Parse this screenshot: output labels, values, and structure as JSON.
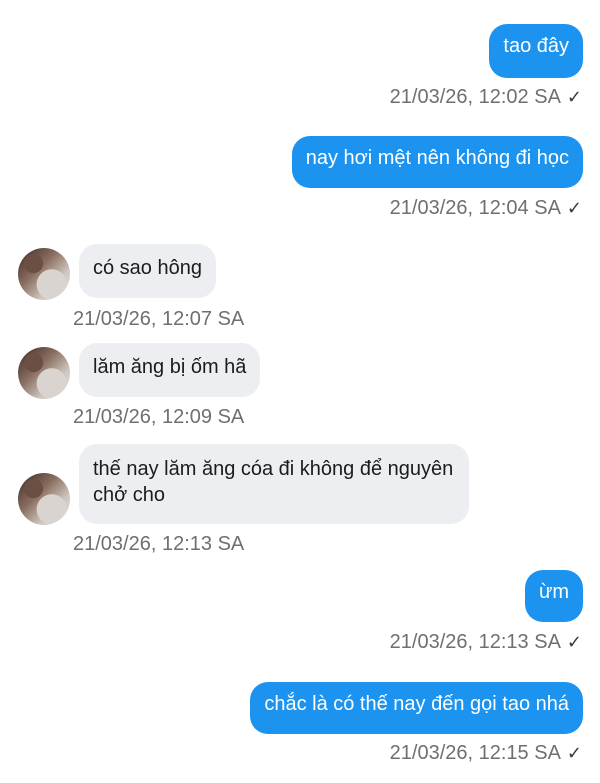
{
  "messages": [
    {
      "side": "out",
      "text": "tao đây",
      "time": "21/03/26, 12:02 SA",
      "status": "✓"
    },
    {
      "side": "out",
      "text": "nay hơi mệt nên không đi học",
      "time": "21/03/26, 12:04 SA",
      "status": "✓"
    },
    {
      "side": "in",
      "text": "có sao hông",
      "time": "21/03/26, 12:07 SA"
    },
    {
      "side": "in",
      "text": "lăm ăng bị ốm hã",
      "time": "21/03/26, 12:09 SA"
    },
    {
      "side": "in",
      "text": "thế nay lăm ăng cóa đi không để nguyên chở cho",
      "time": "21/03/26, 12:13 SA"
    },
    {
      "side": "out",
      "text": "ừm",
      "time": "21/03/26, 12:13 SA",
      "status": "✓"
    },
    {
      "side": "out",
      "text": "chắc là có thế nay đến gọi tao nhá",
      "time": "21/03/26, 12:15 SA",
      "status": "✓"
    }
  ],
  "icons": {
    "status": "check-icon",
    "avatar": "contact-avatar"
  },
  "colors": {
    "outgoing_bubble": "#1c94ef",
    "incoming_bubble": "#eceef1",
    "timestamp": "#6f6f6f"
  }
}
